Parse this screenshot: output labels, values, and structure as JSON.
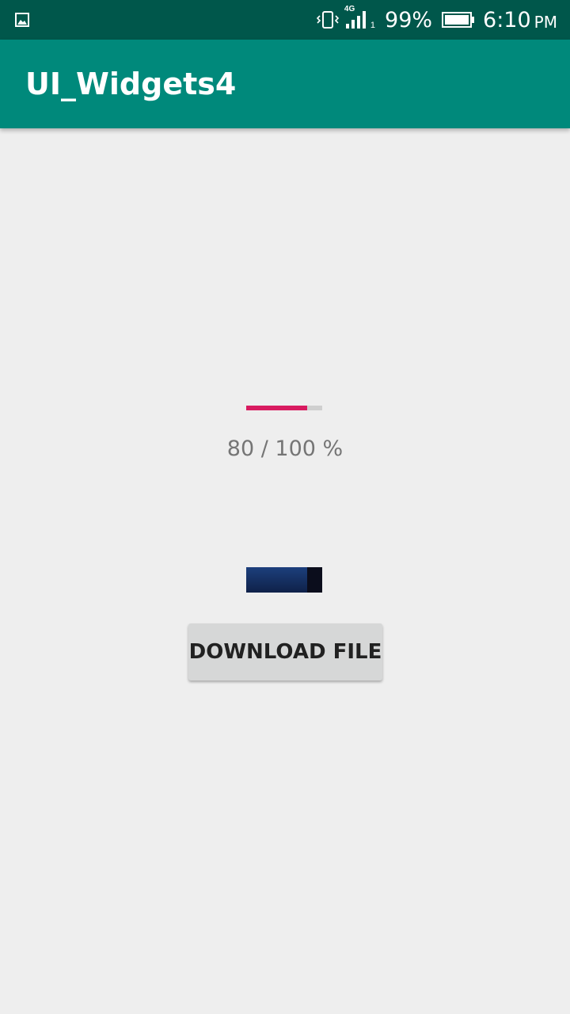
{
  "status_bar": {
    "left_icon": "image-notification-icon",
    "vibrate_icon": "vibrate-icon",
    "network_label": "4G",
    "signal_icon": "signal-icon",
    "sim_slot": "1",
    "battery_percent": "99%",
    "battery_icon": "battery-icon",
    "time": "6:10",
    "ampm": "PM"
  },
  "app_bar": {
    "title": "UI_Widgets4",
    "color": "#00897b"
  },
  "progress": {
    "value": 80,
    "max": 100,
    "label": "80 / 100 %",
    "fill_color": "#d81b60"
  },
  "secondary_progress": {
    "value": 80,
    "max": 100
  },
  "download_button": {
    "label": "DOWNLOAD FILE"
  }
}
